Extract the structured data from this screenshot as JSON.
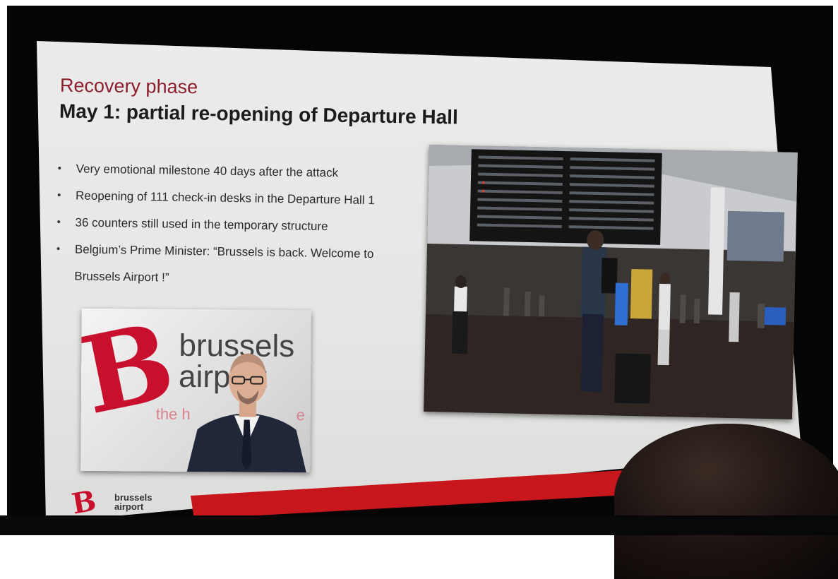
{
  "slide": {
    "title": "Recovery phase",
    "subtitle": "May 1: partial re-opening of Departure Hall",
    "bullets": [
      {
        "line1": "Very emotional milestone 40 days after the attack",
        "line2": ""
      },
      {
        "line1": "Reopening of 111 check-in desks in the Departure Hall 1",
        "line2": ""
      },
      {
        "line1": "36 counters still used in the temporary structure",
        "line2": ""
      },
      {
        "line1": "Belgium’s Prime Minister: “Brussels is back. Welcome to",
        "line2": "Brussels Airport !”"
      }
    ],
    "bullet_glyph": "•"
  },
  "pm_photo": {
    "brand_line1": "brussels",
    "brand_line2": "airport",
    "slogan": "the h",
    "slogan_end": "e"
  },
  "footer": {
    "logo_line1": "brussels",
    "logo_line2": "airport"
  },
  "colors": {
    "brand_red": "#c8102e",
    "title_red": "#8c1f2b",
    "text_dark": "#1c1c1c"
  }
}
